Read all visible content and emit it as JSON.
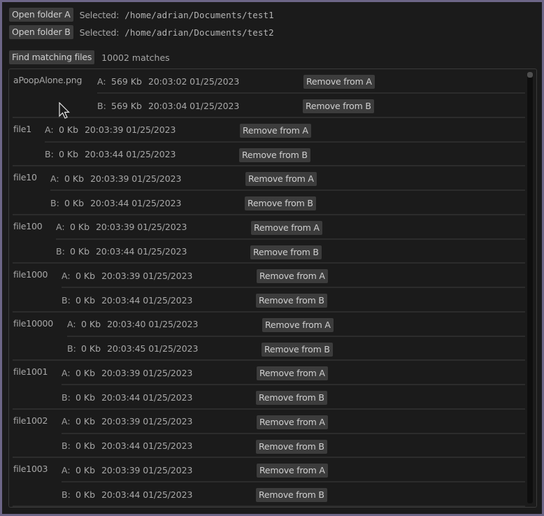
{
  "toolbar": {
    "open_a_label": "Open folder A",
    "open_b_label": "Open folder B",
    "selected_label": "Selected:",
    "folder_a_path": "/home/adrian/Documents/test1",
    "folder_b_path": "/home/adrian/Documents/test2",
    "find_label": "Find matching files",
    "match_count": "10002 matches"
  },
  "labels": {
    "side_a": "A:",
    "side_b": "B:",
    "remove_a": "Remove from A",
    "remove_b": "Remove from B"
  },
  "entries": [
    {
      "name": "aPoopAlone.png",
      "a": {
        "size": "569 Kb",
        "time": "20:03:02 01/25/2023"
      },
      "b": {
        "size": "569 Kb",
        "time": "20:03:04 01/25/2023"
      }
    },
    {
      "name": "file1",
      "a": {
        "size": "0 Kb",
        "time": "20:03:39 01/25/2023"
      },
      "b": {
        "size": "0 Kb",
        "time": "20:03:44 01/25/2023"
      }
    },
    {
      "name": "file10",
      "a": {
        "size": "0 Kb",
        "time": "20:03:39 01/25/2023"
      },
      "b": {
        "size": "0 Kb",
        "time": "20:03:44 01/25/2023"
      }
    },
    {
      "name": "file100",
      "a": {
        "size": "0 Kb",
        "time": "20:03:39 01/25/2023"
      },
      "b": {
        "size": "0 Kb",
        "time": "20:03:44 01/25/2023"
      }
    },
    {
      "name": "file1000",
      "a": {
        "size": "0 Kb",
        "time": "20:03:39 01/25/2023"
      },
      "b": {
        "size": "0 Kb",
        "time": "20:03:44 01/25/2023"
      }
    },
    {
      "name": "file10000",
      "a": {
        "size": "0 Kb",
        "time": "20:03:40 01/25/2023"
      },
      "b": {
        "size": "0 Kb",
        "time": "20:03:45 01/25/2023"
      }
    },
    {
      "name": "file1001",
      "a": {
        "size": "0 Kb",
        "time": "20:03:39 01/25/2023"
      },
      "b": {
        "size": "0 Kb",
        "time": "20:03:44 01/25/2023"
      }
    },
    {
      "name": "file1002",
      "a": {
        "size": "0 Kb",
        "time": "20:03:39 01/25/2023"
      },
      "b": {
        "size": "0 Kb",
        "time": "20:03:44 01/25/2023"
      }
    },
    {
      "name": "file1003",
      "a": {
        "size": "0 Kb",
        "time": "20:03:39 01/25/2023"
      },
      "b": {
        "size": "0 Kb",
        "time": "20:03:44 01/25/2023"
      }
    }
  ],
  "scroll": {
    "position_fraction": 0.0
  }
}
